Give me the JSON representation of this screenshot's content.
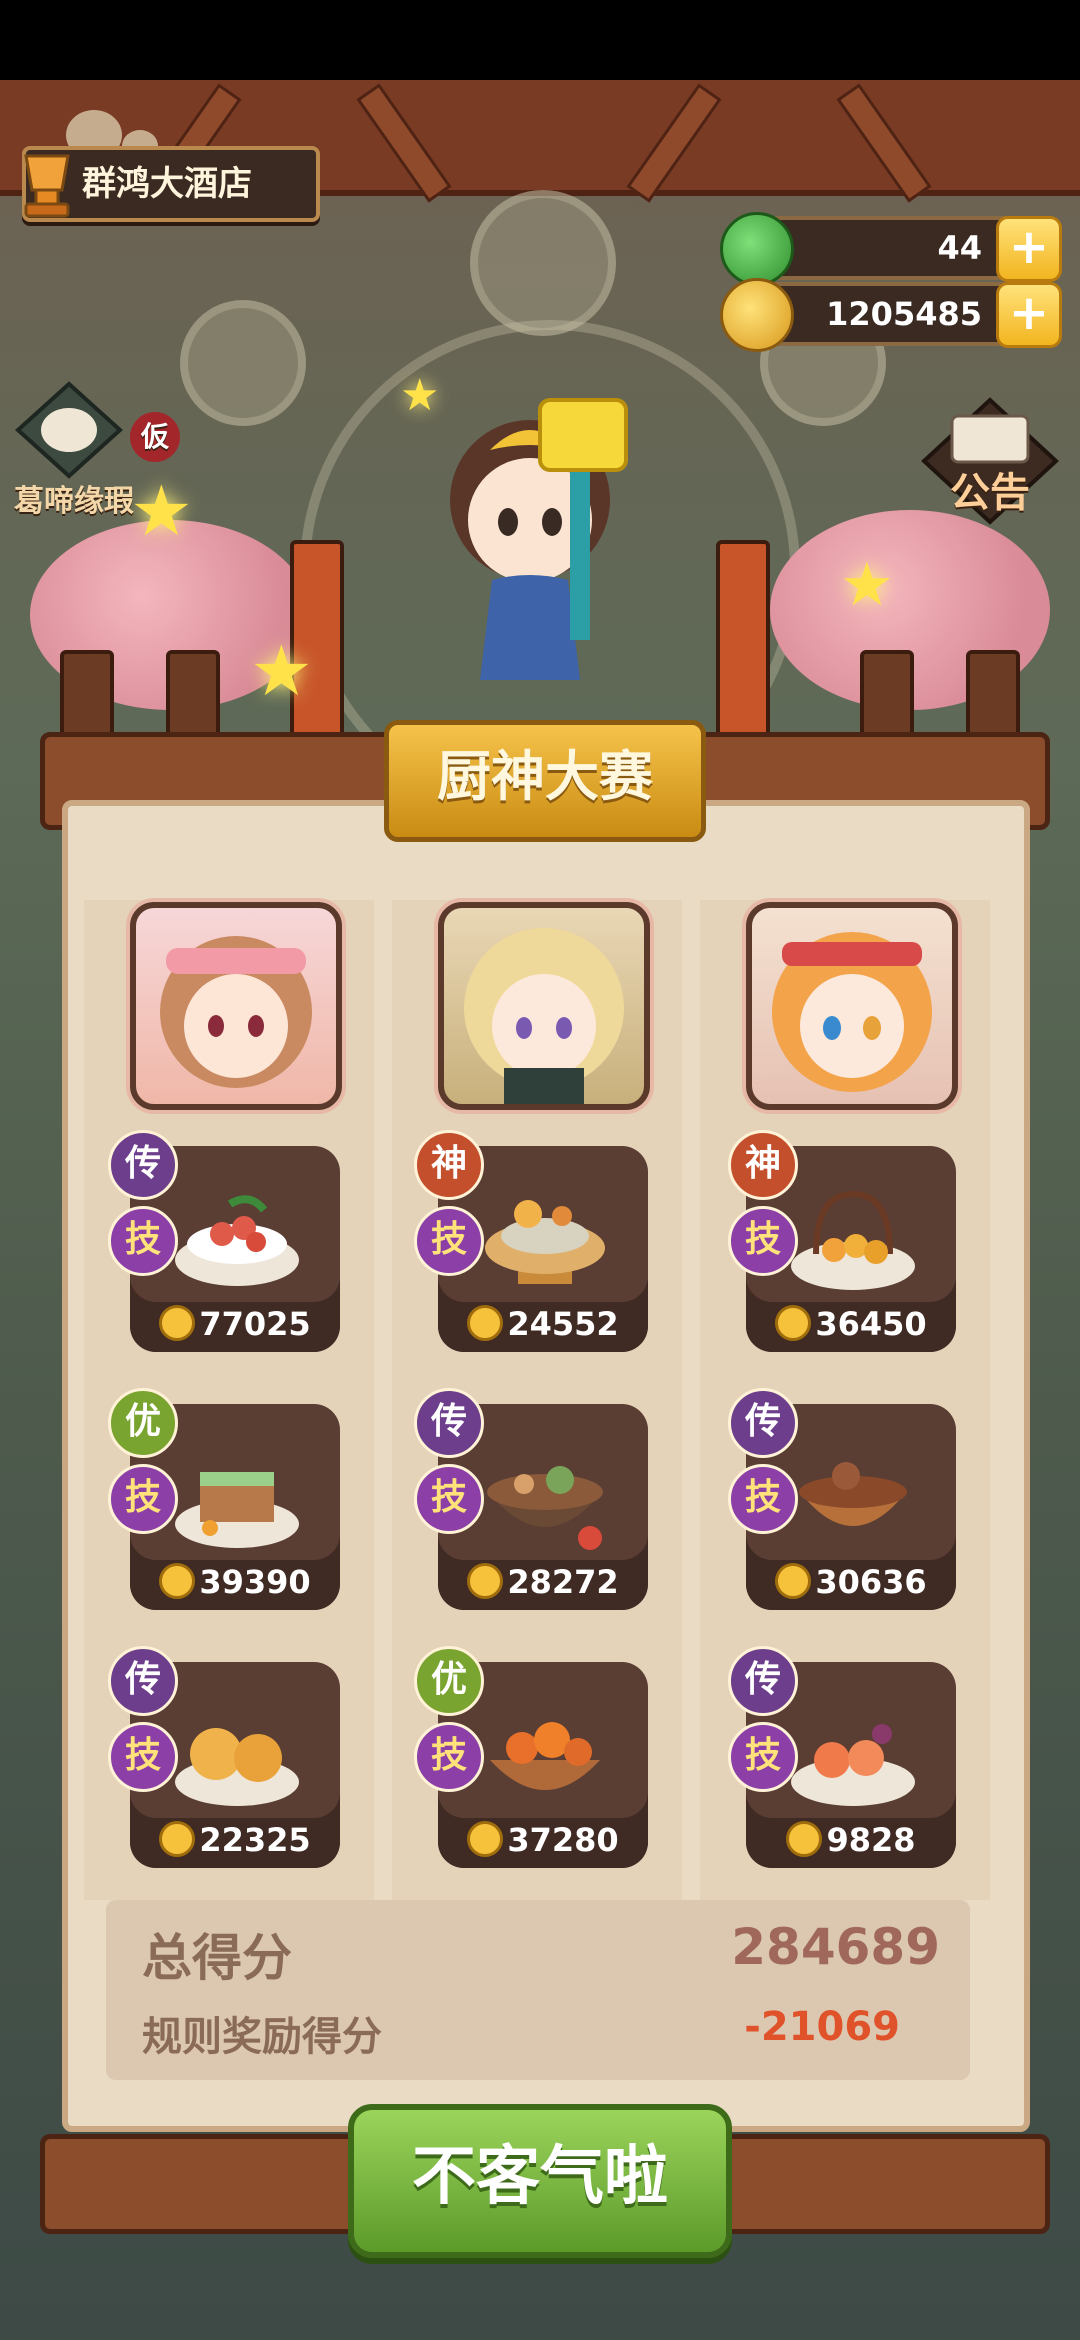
{
  "hud": {
    "hotel_name": "群鸿大酒店",
    "jade": "44",
    "coins": "1205485",
    "side_left": "葛啼缘瑕",
    "side_left_badge": "仮",
    "side_right": "公告"
  },
  "panel": {
    "title": "厨神大赛"
  },
  "columns": [
    {
      "dishes": [
        {
          "grade": "传",
          "skill": "技",
          "cost": "77025"
        },
        {
          "grade": "优",
          "skill": "技",
          "cost": "39390"
        },
        {
          "grade": "传",
          "skill": "技",
          "cost": "22325"
        }
      ]
    },
    {
      "dishes": [
        {
          "grade": "神",
          "skill": "技",
          "cost": "24552"
        },
        {
          "grade": "传",
          "skill": "技",
          "cost": "28272"
        },
        {
          "grade": "优",
          "skill": "技",
          "cost": "37280"
        }
      ]
    },
    {
      "dishes": [
        {
          "grade": "神",
          "skill": "技",
          "cost": "36450"
        },
        {
          "grade": "传",
          "skill": "技",
          "cost": "30636"
        },
        {
          "grade": "传",
          "skill": "技",
          "cost": "9828"
        }
      ]
    }
  ],
  "score": {
    "total_label": "总得分",
    "total_value": "284689",
    "bonus_label": "规则奖励得分",
    "bonus_value": "-21069"
  },
  "action": {
    "confirm_label": "不客气啦"
  },
  "colors": {
    "total_value": "#a0685a",
    "bonus_value": "#e0532a",
    "button": "#7cba3e"
  }
}
